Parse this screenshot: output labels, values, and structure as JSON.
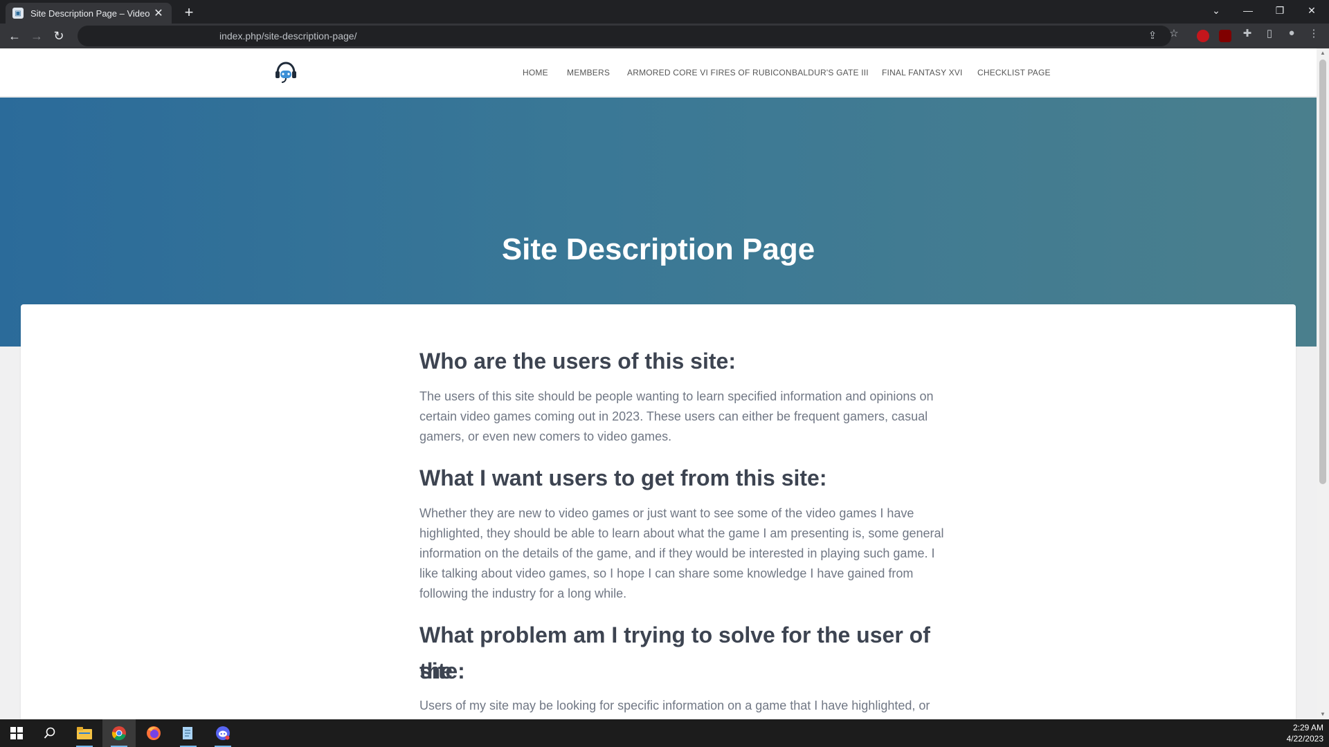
{
  "browser": {
    "tab_title": "Site Description Page – Video Ga",
    "tab_close": "✕",
    "new_tab": "+",
    "url": "index.php/site-description-page/",
    "window_controls": [
      "⌄",
      "—",
      "❐",
      "✕"
    ]
  },
  "site": {
    "nav": [
      "HOME",
      "MEMBERS",
      "ARMORED CORE VI FIRES OF RUBICON",
      "BALDUR'S GATE III",
      "FINAL FANTASY XVI",
      "CHECKLIST PAGE"
    ],
    "page_title": "Site Description Page"
  },
  "article": {
    "heading_1": "Who are the users of this site:",
    "para_1_lines": [
      "The users of this site should be people wanting to learn specified information and opinions on",
      "certain video games coming out in 2023. These users can either be frequent gamers, casual",
      "gamers, or even new comers to video games."
    ],
    "heading_2": "What I want users to get from this site:",
    "para_2_lines": [
      "Whether they are new to video games or just want to see some of the video games I have",
      "highlighted, they should be able to learn about what the game I am presenting is, some general",
      "information on the details of the game, and if they would be interested in playing such game. I",
      "like talking about video games, so I hope I can share some knowledge I have gained from",
      "following the industry for a long while."
    ],
    "heading_3_lines": [
      "What problem am I trying to solve for the user of the",
      "site:"
    ],
    "para_3_partial": "Users of my site may be looking for specific information on a game that I have highlighted, or"
  },
  "taskbar": {
    "time": "2:29 AM",
    "date": "4/22/2023",
    "icons": [
      "windows-start-icon",
      "search-icon",
      "file-explorer-icon",
      "chrome-icon",
      "firefox-icon",
      "notepad-icon",
      "discord-icon"
    ]
  },
  "colors": {
    "hero_start": "#2b6b9a",
    "hero_end": "#4a7f8d",
    "heading": "#3d4451",
    "body_text": "#707784"
  }
}
